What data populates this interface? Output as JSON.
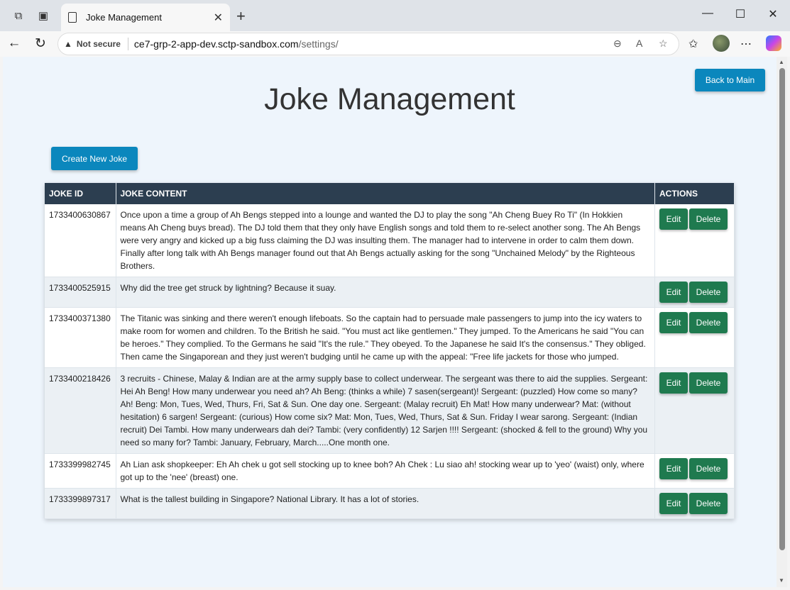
{
  "browser": {
    "tab_title": "Joke Management",
    "security_label": "Not secure",
    "url_host": "ce7-grp-2-app-dev.sctp-sandbox.com",
    "url_path": "/settings/"
  },
  "page": {
    "title": "Joke Management",
    "back_button": "Back to Main",
    "create_button": "Create New Joke"
  },
  "table": {
    "headers": {
      "id": "JOKE ID",
      "content": "JOKE CONTENT",
      "actions": "ACTIONS"
    },
    "edit_label": "Edit",
    "delete_label": "Delete",
    "rows": [
      {
        "id": "1733400630867",
        "content": "Once upon a time a group of Ah Bengs stepped into a lounge and wanted the DJ to play the song \"Ah Cheng Buey Ro Ti\" (In Hokkien means Ah Cheng buys bread). The DJ told them that they only have English songs and told them to re-select another song. The Ah Bengs were very angry and kicked up a big fuss claiming the DJ was insulting them. The manager had to intervene in order to calm them down. Finally after long talk with Ah Bengs manager found out that Ah Bengs actually asking for the song \"Unchained Melody\" by the Righteous Brothers."
      },
      {
        "id": "1733400525915",
        "content": "Why did the tree get struck by lightning? Because it suay."
      },
      {
        "id": "1733400371380",
        "content": "The Titanic was sinking and there weren't enough lifeboats. So the captain had to persuade male passengers to jump into the icy waters to make room for women and children. To the British he said. \"You must act like gentlemen.\" They jumped. To the Americans he said \"You can be heroes.\" They complied. To the Germans he said \"It's the rule.\" They obeyed. To the Japanese he said It's the consensus.\" They obliged. Then came the Singaporean and they just weren't budging until he came up with the appeal: \"Free life jackets for those who jumped."
      },
      {
        "id": "1733400218426",
        "content": "3 recruits - Chinese, Malay & Indian are at the army supply base to collect underwear. The sergeant was there to aid the supplies. Sergeant: Hei Ah Beng! How many underwear you need ah? Ah Beng: (thinks a while) 7 sasen(sergeant)! Sergeant: (puzzled) How come so many? Ah! Beng: Mon, Tues, Wed, Thurs, Fri, Sat & Sun. One day one. Sergeant: (Malay recruit) Eh Mat! How many underwear? Mat: (without hesitation) 6 sargen! Sergeant: (curious) How come six? Mat: Mon, Tues, Wed, Thurs, Sat & Sun. Friday I wear sarong. Sergeant: (Indian recruit) Dei Tambi. How many underwears dah dei? Tambi: (very confidently) 12 Sarjen !!!! Sergeant: (shocked & fell to the ground) Why you need so many for? Tambi: January, February, March.....One month one."
      },
      {
        "id": "1733399982745",
        "content": "Ah Lian ask shopkeeper: Eh Ah chek u got sell stocking up to knee boh? Ah Chek : Lu siao ah! stocking wear up to 'yeo' (waist) only, where got up to the 'nee' (breast) one."
      },
      {
        "id": "1733399897317",
        "content": "What is the tallest building in Singapore? National Library. It has a lot of stories."
      }
    ]
  }
}
